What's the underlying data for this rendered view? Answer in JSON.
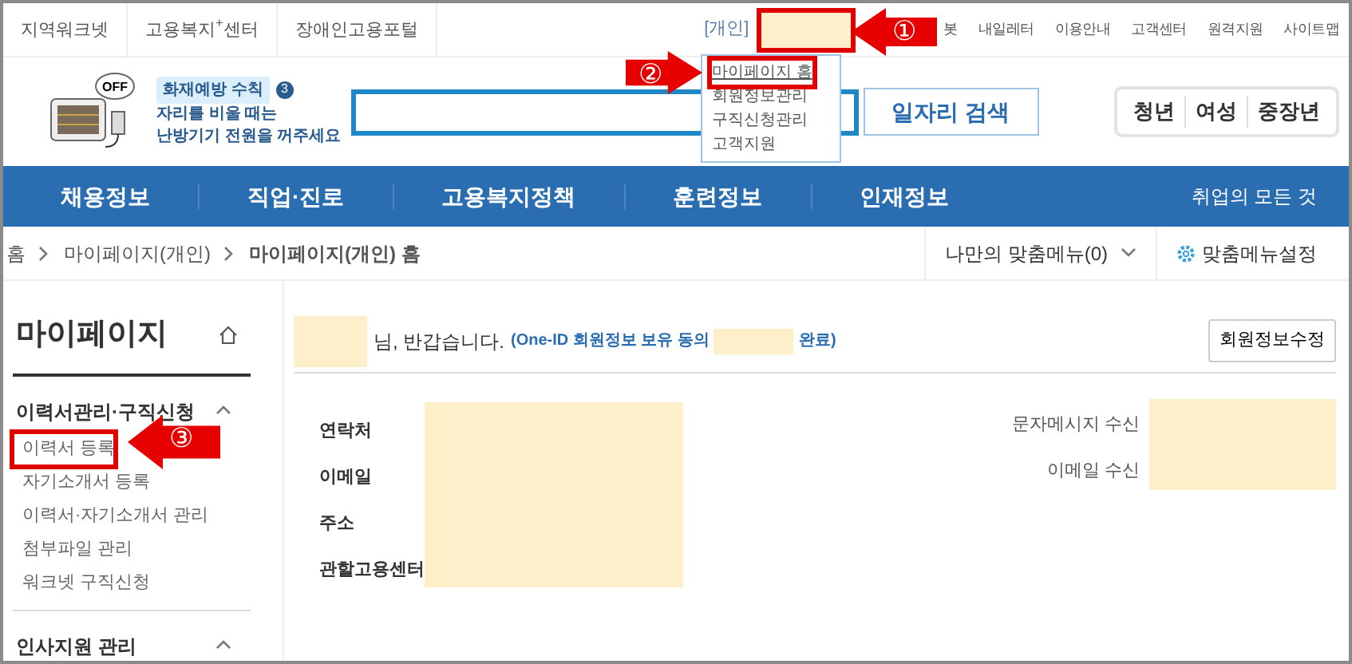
{
  "utility_links": [
    "지역워크넷",
    "고용복지$^{+}$센터",
    "장애인고용포털"
  ],
  "account": {
    "label": "[개인]",
    "user_masked": true,
    "user_highlighted": true,
    "menu": [
      {
        "label": "마이페이지 홈",
        "selected": true,
        "highlighted": true
      },
      {
        "label": "회원정보관리",
        "selected": false,
        "highlighted": false
      },
      {
        "label": "구직신청관리",
        "selected": false,
        "highlighted": false
      },
      {
        "label": "고객지원",
        "selected": false,
        "highlighted": false
      }
    ]
  },
  "top_links": [
    "봇",
    "내일레터",
    "이용안내",
    "고객센터",
    "원격지원",
    "사이트맵"
  ],
  "banner": {
    "badge": "화재예방 수칙",
    "badge_count": "3",
    "lines": [
      "자리를 비울 때는",
      "난방기기 전원을 꺼주세요"
    ],
    "device_label": "OFF"
  },
  "search": {
    "button": "일자리 검색"
  },
  "audience_links": [
    "청년",
    "여성",
    "중장년"
  ],
  "nav": {
    "items": [
      "채용정보",
      "직업·진로",
      "고용복지정책",
      "훈련정보",
      "인재정보"
    ],
    "right": "취업의 모든 것"
  },
  "breadcrumb": [
    "홈",
    "마이페이지(개인)",
    "마이페이지(개인) 홈"
  ],
  "custom_menu": "나만의 맞춤메뉴(0)",
  "custom_settings": "맞춤메뉴설정",
  "sidebar": {
    "title": "마이페이지",
    "sections": [
      {
        "title": "이력서관리·구직신청",
        "expanded": true,
        "items": [
          {
            "label": "이력서 등록",
            "highlighted": true
          },
          {
            "label": "자기소개서 등록",
            "highlighted": false
          },
          {
            "label": "이력서·자기소개서 관리",
            "highlighted": false
          },
          {
            "label": "첨부파일 관리",
            "highlighted": false
          },
          {
            "label": "워크넷 구직신청",
            "highlighted": false
          }
        ]
      },
      {
        "title": "인사지원 관리",
        "expanded": true
      }
    ]
  },
  "greeting": {
    "name_masked": true,
    "text": "님, 반갑습니다.",
    "consent_prefix": "(One-ID 회원정보 보유 동의",
    "consent_masked": true,
    "consent_suffix": "완료)",
    "edit_button": "회원정보수정"
  },
  "profile_left": [
    {
      "label": "연락처"
    },
    {
      "label": "이메일"
    },
    {
      "label": "주소"
    },
    {
      "label": "관할고용센터"
    }
  ],
  "profile_left_masked": true,
  "profile_right": [
    {
      "label": "문자메시지 수신"
    },
    {
      "label": "이메일 수신"
    }
  ],
  "profile_right_masked": true,
  "annotations": [
    {
      "number": "①",
      "kind": "left"
    },
    {
      "number": "②",
      "kind": "right"
    },
    {
      "number": "③",
      "kind": "left"
    }
  ]
}
